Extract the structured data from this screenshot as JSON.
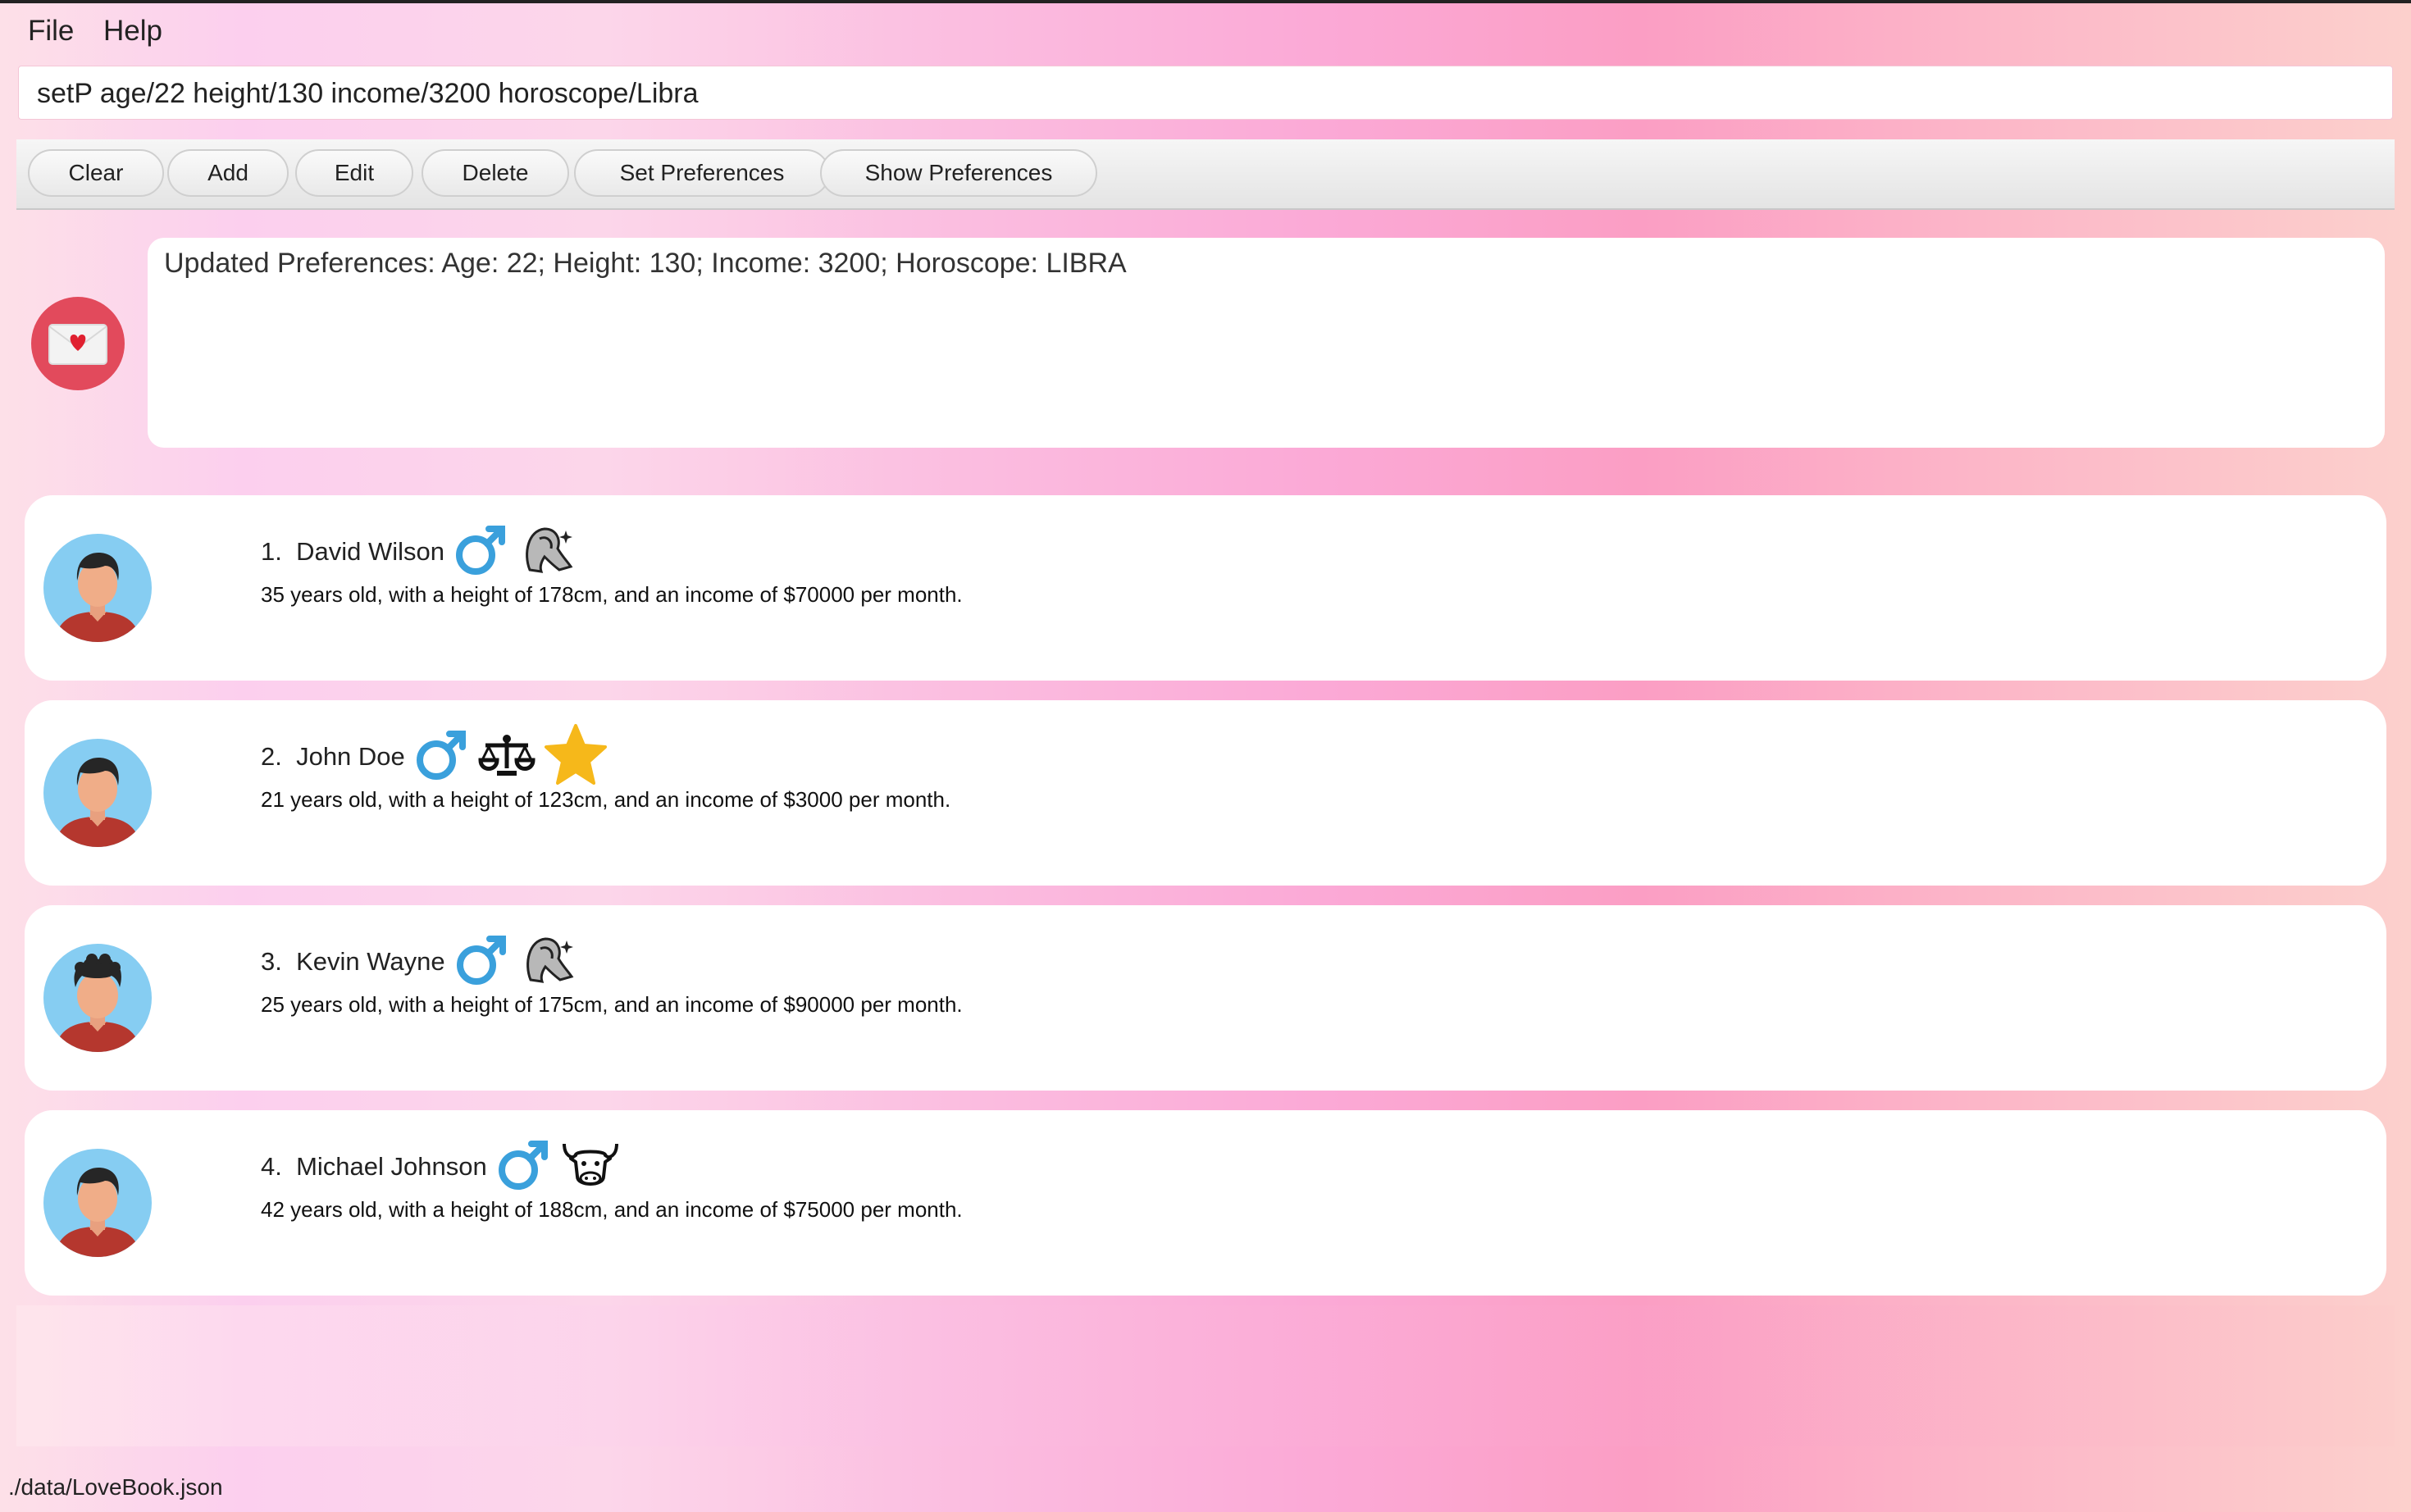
{
  "menu": {
    "file": "File",
    "help": "Help"
  },
  "command": {
    "value": "setP age/22 height/130 income/3200 horoscope/Libra"
  },
  "toolbar": {
    "clear": "Clear",
    "add": "Add",
    "edit": "Edit",
    "delete": "Delete",
    "set_preferences": "Set Preferences",
    "show_preferences": "Show Preferences"
  },
  "result": {
    "icon": "love-letter-icon",
    "text": "Updated Preferences: Age: 22; Height: 130; Income: 3200; Horoscope: LIBRA"
  },
  "persons": [
    {
      "name": "1.  David Wilson",
      "details": "35 years old, with a height of 178cm, and an income of $70000 per month.",
      "icons": [
        "male-icon",
        "virgo-icon"
      ]
    },
    {
      "name": "2.  John Doe",
      "details": "21 years old, with a height of 123cm, and an income of $3000 per month.",
      "icons": [
        "male-icon",
        "libra-icon",
        "star-icon"
      ]
    },
    {
      "name": "3.  Kevin Wayne",
      "details": "25 years old, with a height of 175cm, and an income of $90000 per month.",
      "icons": [
        "male-icon",
        "virgo-icon"
      ]
    },
    {
      "name": "4.  Michael Johnson",
      "details": "42 years old, with a height of 188cm, and an income of $75000 per month.",
      "icons": [
        "male-icon",
        "taurus-icon"
      ]
    }
  ],
  "status": {
    "path": "./data/LoveBook.json"
  },
  "colors": {
    "accent": "#e24a5c",
    "male": "#3aa0dc",
    "star": "#f6b81a"
  }
}
